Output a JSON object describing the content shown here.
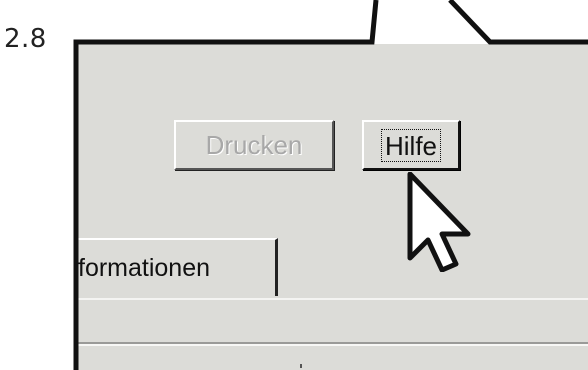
{
  "figure": {
    "step_number": "2.8"
  },
  "dialog": {
    "buttons": {
      "print_label": "Drucken",
      "print_enabled": false,
      "help_label": "Hilfe",
      "help_focused": true
    },
    "tab": {
      "label": "formationen"
    }
  },
  "cursor": {
    "type": "arrow-pointer-icon",
    "hover_target": "help-button"
  },
  "colors": {
    "window_background": "#dcdcd8",
    "disabled_text": "#a8a8a8",
    "text": "#111111",
    "callout_outline": "#111111"
  }
}
